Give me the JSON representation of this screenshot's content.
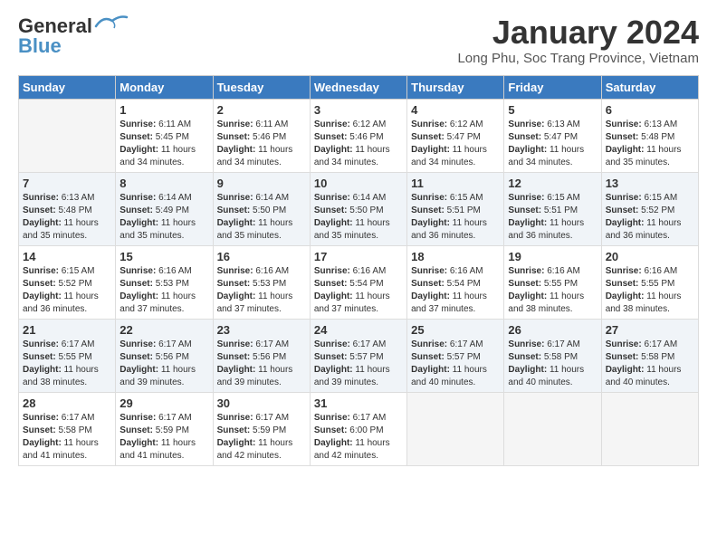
{
  "header": {
    "logo_general": "General",
    "logo_blue": "Blue",
    "month_title": "January 2024",
    "location": "Long Phu, Soc Trang Province, Vietnam"
  },
  "days_of_week": [
    "Sunday",
    "Monday",
    "Tuesday",
    "Wednesday",
    "Thursday",
    "Friday",
    "Saturday"
  ],
  "weeks": [
    [
      {
        "day": "",
        "sunrise": "",
        "sunset": "",
        "daylight": "",
        "empty": true
      },
      {
        "day": "1",
        "sunrise": "6:11 AM",
        "sunset": "5:45 PM",
        "daylight": "11 hours and 34 minutes."
      },
      {
        "day": "2",
        "sunrise": "6:11 AM",
        "sunset": "5:46 PM",
        "daylight": "11 hours and 34 minutes."
      },
      {
        "day": "3",
        "sunrise": "6:12 AM",
        "sunset": "5:46 PM",
        "daylight": "11 hours and 34 minutes."
      },
      {
        "day": "4",
        "sunrise": "6:12 AM",
        "sunset": "5:47 PM",
        "daylight": "11 hours and 34 minutes."
      },
      {
        "day": "5",
        "sunrise": "6:13 AM",
        "sunset": "5:47 PM",
        "daylight": "11 hours and 34 minutes."
      },
      {
        "day": "6",
        "sunrise": "6:13 AM",
        "sunset": "5:48 PM",
        "daylight": "11 hours and 35 minutes."
      }
    ],
    [
      {
        "day": "7",
        "sunrise": "6:13 AM",
        "sunset": "5:48 PM",
        "daylight": "11 hours and 35 minutes."
      },
      {
        "day": "8",
        "sunrise": "6:14 AM",
        "sunset": "5:49 PM",
        "daylight": "11 hours and 35 minutes."
      },
      {
        "day": "9",
        "sunrise": "6:14 AM",
        "sunset": "5:50 PM",
        "daylight": "11 hours and 35 minutes."
      },
      {
        "day": "10",
        "sunrise": "6:14 AM",
        "sunset": "5:50 PM",
        "daylight": "11 hours and 35 minutes."
      },
      {
        "day": "11",
        "sunrise": "6:15 AM",
        "sunset": "5:51 PM",
        "daylight": "11 hours and 36 minutes."
      },
      {
        "day": "12",
        "sunrise": "6:15 AM",
        "sunset": "5:51 PM",
        "daylight": "11 hours and 36 minutes."
      },
      {
        "day": "13",
        "sunrise": "6:15 AM",
        "sunset": "5:52 PM",
        "daylight": "11 hours and 36 minutes."
      }
    ],
    [
      {
        "day": "14",
        "sunrise": "6:15 AM",
        "sunset": "5:52 PM",
        "daylight": "11 hours and 36 minutes."
      },
      {
        "day": "15",
        "sunrise": "6:16 AM",
        "sunset": "5:53 PM",
        "daylight": "11 hours and 37 minutes."
      },
      {
        "day": "16",
        "sunrise": "6:16 AM",
        "sunset": "5:53 PM",
        "daylight": "11 hours and 37 minutes."
      },
      {
        "day": "17",
        "sunrise": "6:16 AM",
        "sunset": "5:54 PM",
        "daylight": "11 hours and 37 minutes."
      },
      {
        "day": "18",
        "sunrise": "6:16 AM",
        "sunset": "5:54 PM",
        "daylight": "11 hours and 37 minutes."
      },
      {
        "day": "19",
        "sunrise": "6:16 AM",
        "sunset": "5:55 PM",
        "daylight": "11 hours and 38 minutes."
      },
      {
        "day": "20",
        "sunrise": "6:16 AM",
        "sunset": "5:55 PM",
        "daylight": "11 hours and 38 minutes."
      }
    ],
    [
      {
        "day": "21",
        "sunrise": "6:17 AM",
        "sunset": "5:55 PM",
        "daylight": "11 hours and 38 minutes."
      },
      {
        "day": "22",
        "sunrise": "6:17 AM",
        "sunset": "5:56 PM",
        "daylight": "11 hours and 39 minutes."
      },
      {
        "day": "23",
        "sunrise": "6:17 AM",
        "sunset": "5:56 PM",
        "daylight": "11 hours and 39 minutes."
      },
      {
        "day": "24",
        "sunrise": "6:17 AM",
        "sunset": "5:57 PM",
        "daylight": "11 hours and 39 minutes."
      },
      {
        "day": "25",
        "sunrise": "6:17 AM",
        "sunset": "5:57 PM",
        "daylight": "11 hours and 40 minutes."
      },
      {
        "day": "26",
        "sunrise": "6:17 AM",
        "sunset": "5:58 PM",
        "daylight": "11 hours and 40 minutes."
      },
      {
        "day": "27",
        "sunrise": "6:17 AM",
        "sunset": "5:58 PM",
        "daylight": "11 hours and 40 minutes."
      }
    ],
    [
      {
        "day": "28",
        "sunrise": "6:17 AM",
        "sunset": "5:58 PM",
        "daylight": "11 hours and 41 minutes."
      },
      {
        "day": "29",
        "sunrise": "6:17 AM",
        "sunset": "5:59 PM",
        "daylight": "11 hours and 41 minutes."
      },
      {
        "day": "30",
        "sunrise": "6:17 AM",
        "sunset": "5:59 PM",
        "daylight": "11 hours and 42 minutes."
      },
      {
        "day": "31",
        "sunrise": "6:17 AM",
        "sunset": "6:00 PM",
        "daylight": "11 hours and 42 minutes."
      },
      {
        "day": "",
        "sunrise": "",
        "sunset": "",
        "daylight": "",
        "empty": true
      },
      {
        "day": "",
        "sunrise": "",
        "sunset": "",
        "daylight": "",
        "empty": true
      },
      {
        "day": "",
        "sunrise": "",
        "sunset": "",
        "daylight": "",
        "empty": true
      }
    ]
  ],
  "labels": {
    "sunrise": "Sunrise:",
    "sunset": "Sunset:",
    "daylight": "Daylight:"
  }
}
